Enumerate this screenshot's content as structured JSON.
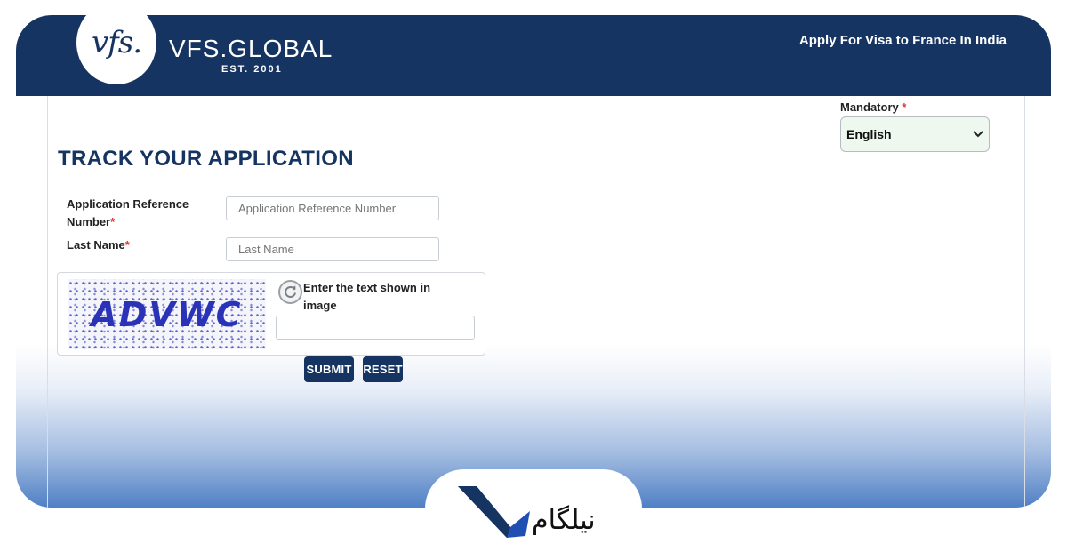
{
  "header": {
    "logo_mark": "vfs.",
    "brand_name": "VFS.GLOBAL",
    "brand_est": "EST. 2001",
    "title": "Apply For Visa to France  In India",
    "background_color": "#163461"
  },
  "language": {
    "mandatory_label": "Mandatory",
    "required_marker": "*",
    "selected": "English",
    "chevron_icon": "chevron-down-icon"
  },
  "form": {
    "page_title": "TRACK YOUR APPLICATION",
    "reference_label_line1": "Application Reference",
    "reference_label_line2": "Number",
    "reference_placeholder": "Application Reference Number",
    "last_name_label": "Last Name",
    "last_name_placeholder": "Last Name",
    "required_marker": "*"
  },
  "captcha": {
    "image_text": "ADVWC",
    "refresh_icon": "refresh-icon",
    "prompt": "Enter the text shown in image",
    "value": ""
  },
  "buttons": {
    "submit": "SUBMIT",
    "reset": "RESET",
    "color": "#163461"
  },
  "watermark": {
    "brand": "نیلگام"
  }
}
